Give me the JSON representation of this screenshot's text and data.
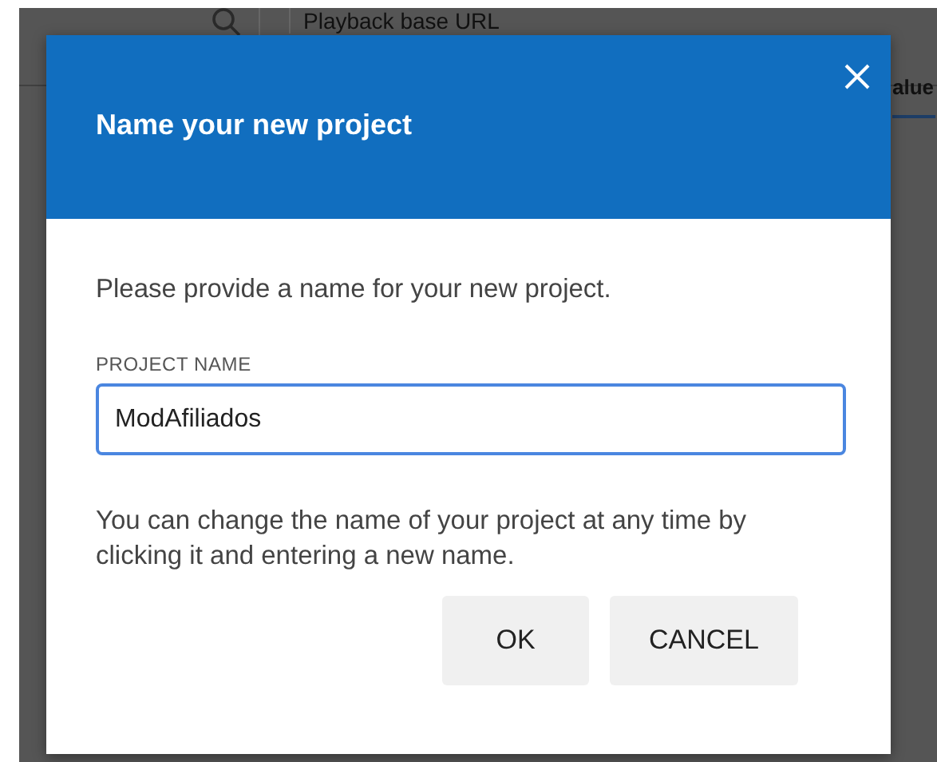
{
  "background": {
    "search": {
      "placeholder": "Playback base URL"
    },
    "tab_label": "alue"
  },
  "dialog": {
    "title": "Name your new project",
    "message": "Please provide a name for your new project.",
    "field": {
      "label": "PROJECT NAME",
      "value": "ModAfiliados"
    },
    "hint": "You can change the name of your project at any time by clicking it and entering a new name.",
    "buttons": [
      "OK",
      "CANCEL"
    ]
  }
}
